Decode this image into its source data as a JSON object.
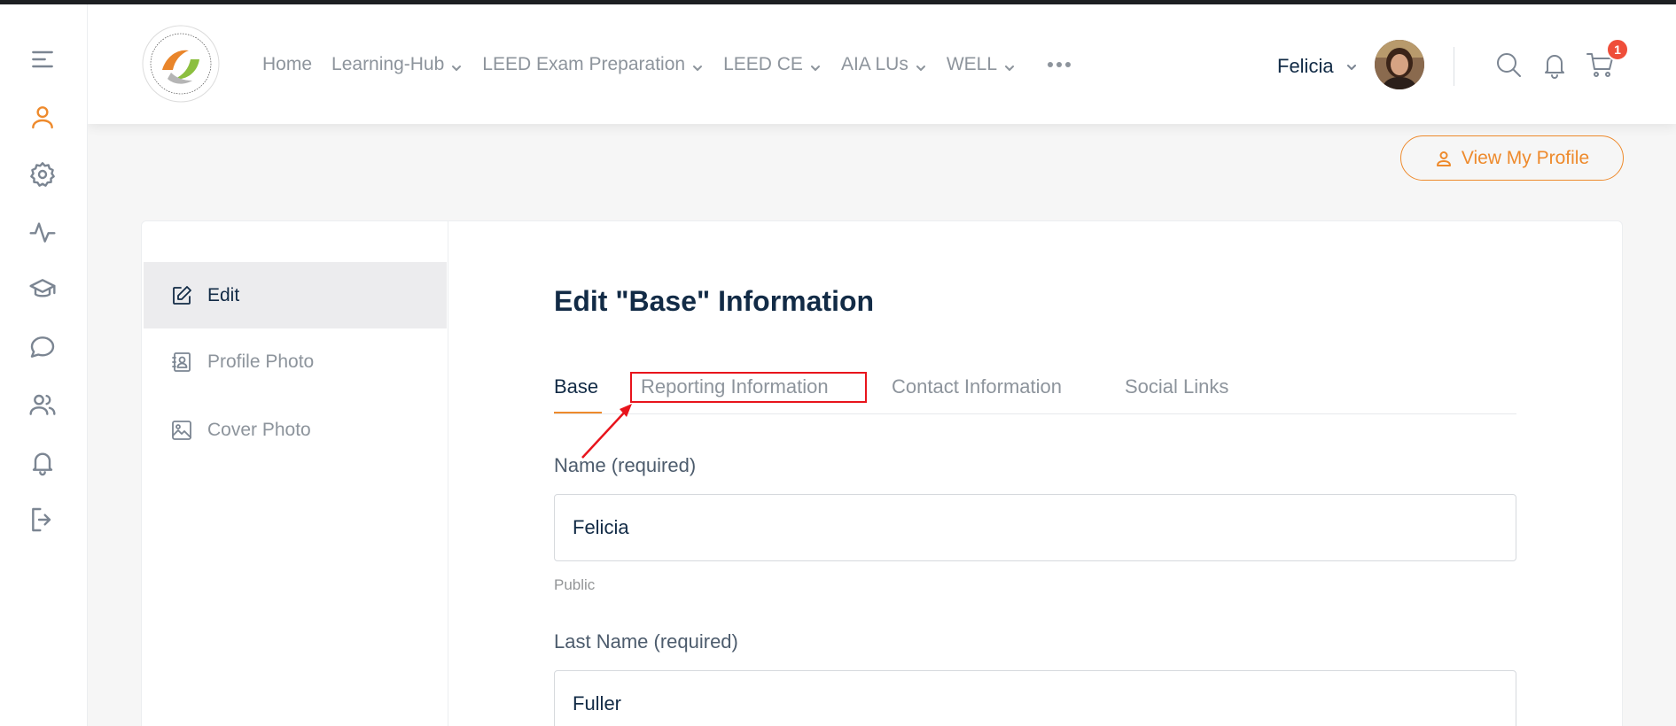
{
  "header": {
    "nav": [
      {
        "label": "Home",
        "has_dropdown": false
      },
      {
        "label": "Learning-Hub",
        "has_dropdown": true
      },
      {
        "label": "LEED Exam Preparation",
        "has_dropdown": true
      },
      {
        "label": "LEED CE",
        "has_dropdown": true
      },
      {
        "label": "AIA LUs",
        "has_dropdown": true
      },
      {
        "label": "WELL",
        "has_dropdown": true
      }
    ],
    "more_icon": "ellipsis-icon",
    "user_name": "Felicia",
    "cart_count": "1",
    "icons": [
      "search-icon",
      "bell-icon",
      "cart-icon"
    ]
  },
  "sidebar": {
    "icons": [
      "menu-icon",
      "profile-icon",
      "settings-icon",
      "activity-icon",
      "courses-icon",
      "messages-icon",
      "members-icon",
      "notifications-icon",
      "logout-icon"
    ],
    "active": "profile-icon"
  },
  "profile": {
    "view_button": "View My Profile",
    "nav": [
      {
        "label": "Edit",
        "icon": "edit-icon",
        "active": true
      },
      {
        "label": "Profile Photo",
        "icon": "contact-card-icon",
        "active": false
      },
      {
        "label": "Cover Photo",
        "icon": "image-icon",
        "active": false
      }
    ],
    "heading": "Edit \"Base\" Information",
    "tabs": [
      {
        "label": "Base",
        "active": true
      },
      {
        "label": "Reporting Information",
        "active": false
      },
      {
        "label": "Contact Information",
        "active": false
      },
      {
        "label": "Social Links",
        "active": false
      }
    ],
    "fields": [
      {
        "label": "Name (required)",
        "value": "Felicia",
        "hint": "Public"
      },
      {
        "label": "Last Name (required)",
        "value": "Fuller"
      }
    ]
  },
  "colors": {
    "accent": "#ee8a2c",
    "text_dark": "#122b46",
    "text_muted": "#8d949c",
    "badge": "#ef4e3a",
    "annotation": "#e8141c"
  }
}
